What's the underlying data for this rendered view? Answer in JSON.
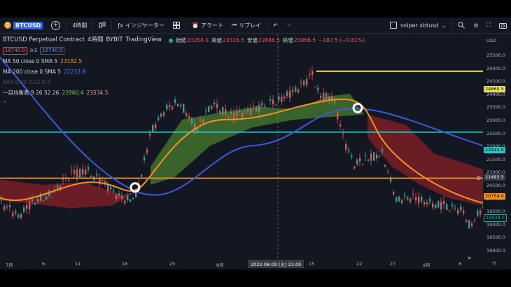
{
  "toolbar": {
    "symbol_short": "BTCUSD",
    "timeframe": "4時間",
    "indicators": "インジケーター",
    "alert": "アラート",
    "replay": "リプレイ",
    "layout_name": "sniper xbtusd",
    "usd_label": "USD"
  },
  "header": {
    "title": "BTCUSD Perpetual Contract",
    "interval": "4時間",
    "exchange": "BYBIT",
    "platform": "TradingView",
    "open_label": "始値",
    "open_value": "23254.0",
    "high_label": "高値",
    "high_value": "23316.5",
    "low_label": "安値",
    "low_value": "22846.5",
    "close_label": "終値",
    "close_value": "23066.5",
    "change": "−187.5 (−0.81%)",
    "bid": "16740.0",
    "spread": "0.5",
    "ask": "16740.5"
  },
  "indicators": {
    "ma50_label": "MA 50 close 0 SMA 5",
    "ma50_value": "23182.5",
    "ma200_label": "MA 200 close 0 SMA 5",
    "ma200_value": "22233.8",
    "sar_label": "SAR 0.02 0.02 0.2",
    "ichimoku_label": "一目均衡表 9 26 52 26",
    "ichimoku_v1": "22960.4",
    "ichimoku_v2": "23534.5"
  },
  "price_axis": {
    "ticks": [
      "25500.0",
      "25000.0",
      "24500.0",
      "24000.0",
      "23500.0",
      "23000.0",
      "22500.0",
      "22000.0",
      "21500.0",
      "21000.0",
      "20500.0",
      "20000.0",
      "19500.0",
      "19000.0",
      "18500.0",
      "18000.0"
    ],
    "yellow_label": "24860.5",
    "cyan_label": "22522.0",
    "cursor_label": "21493.5",
    "orange_label": "20754.0",
    "last_label": "19938.0"
  },
  "time_axis": {
    "ticks": [
      "7月",
      "6",
      "11",
      "18",
      "25",
      "8月",
      "15",
      "22",
      "27",
      "9月",
      "6"
    ],
    "cursor_label": "2022-08-09 (火)  21:00"
  },
  "colors": {
    "yellow_line": "#f5e642",
    "cyan_line": "#2ec4c4",
    "orange_line": "#f5921e",
    "ma200": "#3a5bd9",
    "ma50": "#f5921e",
    "bull": "#26a69a",
    "bear": "#ef5350",
    "cloud_green": "#3f6b2e",
    "cloud_red": "#7a1e24"
  }
}
